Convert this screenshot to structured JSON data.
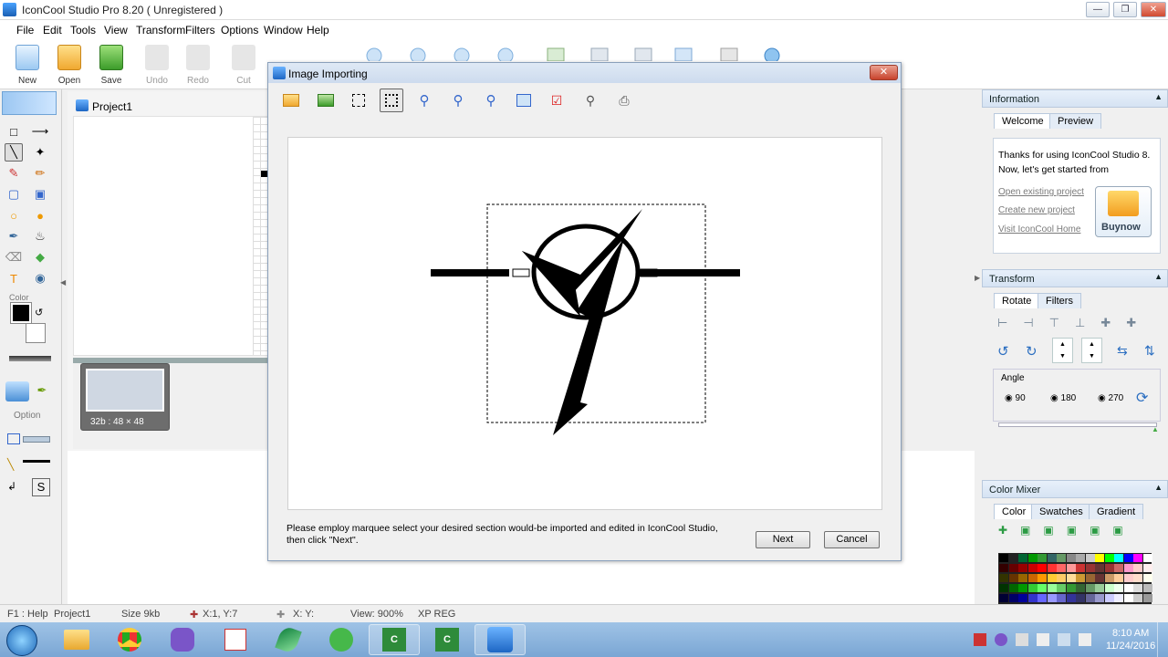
{
  "window": {
    "title": "IconCool Studio Pro 8.20 ( Unregistered )"
  },
  "menu": [
    "File",
    "Edit",
    "Tools",
    "View",
    "Transform",
    "Filters",
    "Options",
    "Window",
    "Help"
  ],
  "toolbar": {
    "new": "New",
    "open": "Open",
    "save": "Save",
    "undo": "Undo",
    "redo": "Redo",
    "cut": "Cut"
  },
  "left_tools": {
    "color_label": "Color",
    "option_label": "Option"
  },
  "project": {
    "tab": "Project1",
    "thumb_label": "32b : 48 × 48"
  },
  "info_panel": {
    "title": "Information",
    "tabs": [
      "Welcome",
      "Preview"
    ],
    "welcome_text": "Thanks for using IconCool Studio 8. Now, let's get started from",
    "links": [
      "Open existing project",
      "Create new project",
      "Visit IconCool Home"
    ],
    "buynow": "Buynow"
  },
  "transform_panel": {
    "title": "Transform",
    "tabs": [
      "Rotate",
      "Filters"
    ],
    "angle_label": "Angle",
    "angles": [
      "90",
      "180",
      "270"
    ]
  },
  "color_mixer": {
    "title": "Color Mixer",
    "tabs": [
      "Color",
      "Swatches",
      "Gradient"
    ]
  },
  "dialog": {
    "title": "Image Importing",
    "instructions_line1": "Please employ marquee select your desired section would-be imported and edited in IconCool Studio,",
    "instructions_line2": " then click \"Next\".",
    "next": "Next",
    "cancel": "Cancel"
  },
  "status": {
    "help": "F1 : Help",
    "project": "Project1",
    "size": "Size   9kb",
    "pos": "X:1, Y:7",
    "xy": "X: Y:",
    "view": "View: 900%",
    "reg": "XP REG"
  },
  "taskbar": {
    "time": "8:10 AM",
    "date": "11/24/2016"
  }
}
